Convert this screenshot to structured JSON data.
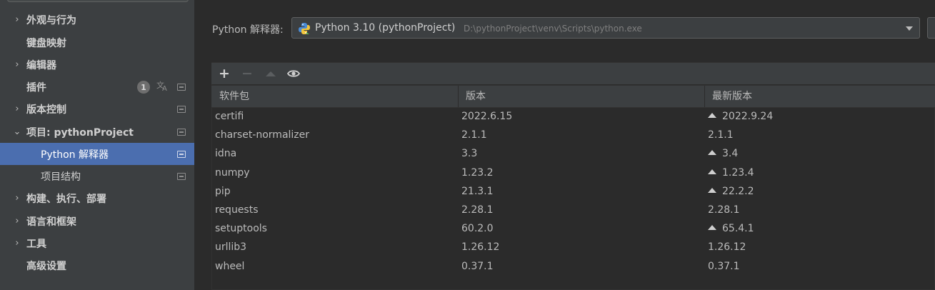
{
  "sidebar": {
    "items": [
      {
        "label": "外观与行为",
        "chevron": "›"
      },
      {
        "label": "键盘映射"
      },
      {
        "label": "编辑器",
        "chevron": "›"
      },
      {
        "label": "插件",
        "badge": "1"
      },
      {
        "label": "版本控制",
        "chevron": "›"
      },
      {
        "label": "项目: pythonProject",
        "chevron": "⌄"
      },
      {
        "label": "Python 解释器",
        "selected": true
      },
      {
        "label": "项目结构"
      },
      {
        "label": "构建、执行、部署",
        "chevron": "›"
      },
      {
        "label": "语言和框架",
        "chevron": "›"
      },
      {
        "label": "工具",
        "chevron": "›"
      },
      {
        "label": "高级设置"
      }
    ]
  },
  "interpreter": {
    "label": "Python 解释器:",
    "name": "Python 3.10 (pythonProject)",
    "path": "D:\\pythonProject\\venv\\Scripts\\python.exe"
  },
  "toolbar": {
    "add": "+",
    "remove": "−"
  },
  "table": {
    "headers": [
      "软件包",
      "版本",
      "最新版本"
    ],
    "rows": [
      {
        "name": "certifi",
        "version": "2022.6.15",
        "latest": "2022.9.24",
        "upgrade": true
      },
      {
        "name": "charset-normalizer",
        "version": "2.1.1",
        "latest": "2.1.1",
        "upgrade": false
      },
      {
        "name": "idna",
        "version": "3.3",
        "latest": "3.4",
        "upgrade": true
      },
      {
        "name": "numpy",
        "version": "1.23.2",
        "latest": "1.23.4",
        "upgrade": true
      },
      {
        "name": "pip",
        "version": "21.3.1",
        "latest": "22.2.2",
        "upgrade": true
      },
      {
        "name": "requests",
        "version": "2.28.1",
        "latest": "2.28.1",
        "upgrade": false
      },
      {
        "name": "setuptools",
        "version": "60.2.0",
        "latest": "65.4.1",
        "upgrade": true
      },
      {
        "name": "urllib3",
        "version": "1.26.12",
        "latest": "1.26.12",
        "upgrade": false
      },
      {
        "name": "wheel",
        "version": "0.37.1",
        "latest": "0.37.1",
        "upgrade": false
      }
    ]
  },
  "colors": {
    "selection": "#4b6eaf",
    "sidebar_bg": "#3c3f41",
    "panel_bg": "#2b2b2b"
  }
}
